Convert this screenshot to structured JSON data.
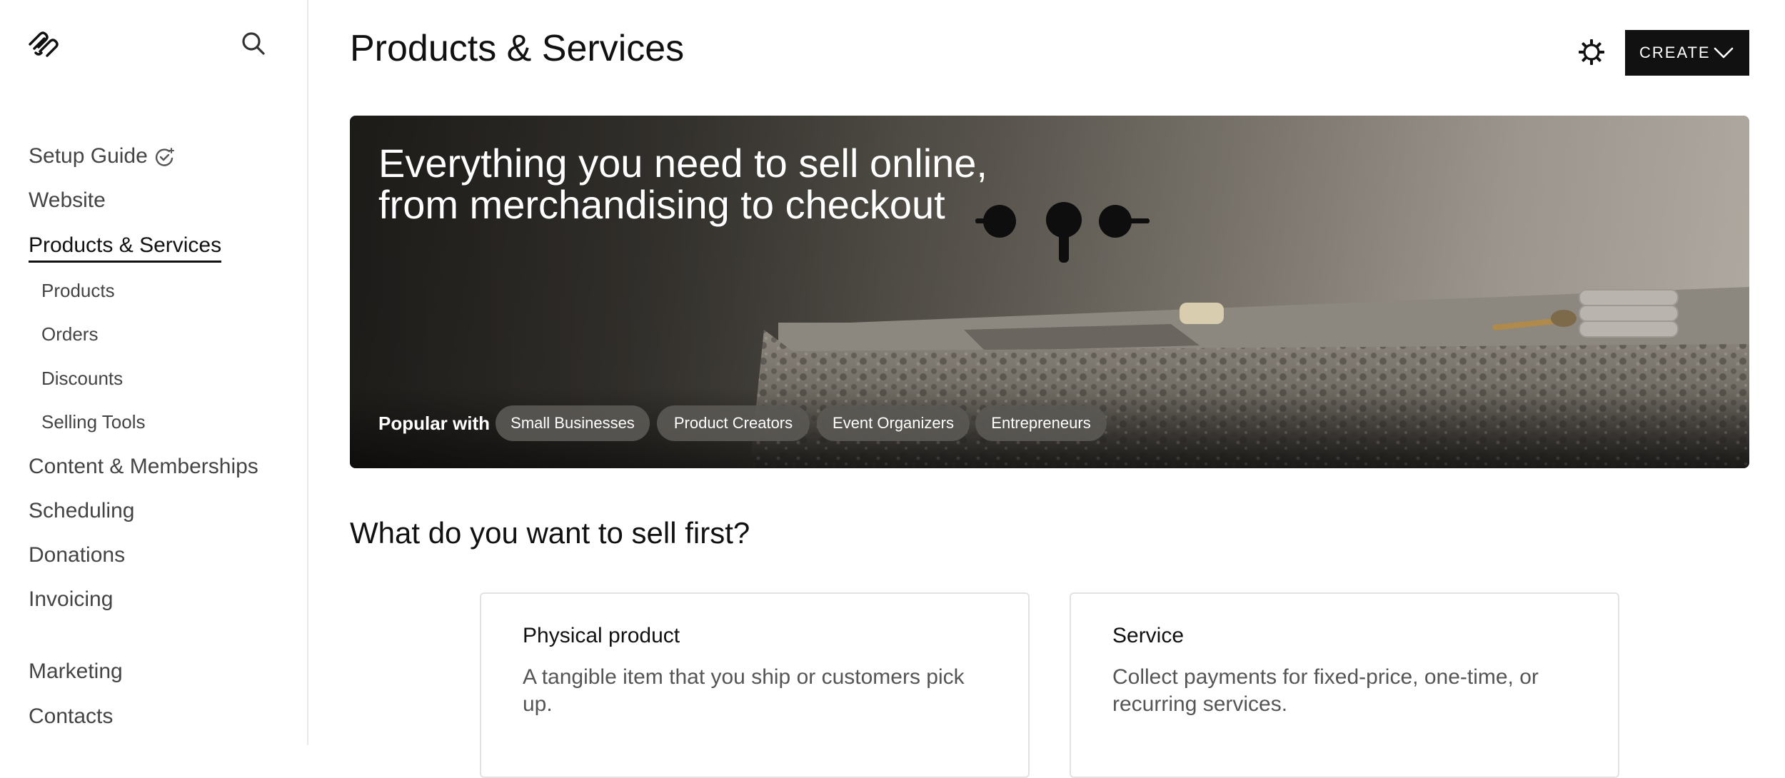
{
  "sidebar": {
    "logo_icon": "squarespace-logo-icon",
    "search_icon": "search-icon",
    "setup_guide": "Setup Guide",
    "items": [
      {
        "label": "Website"
      },
      {
        "label": "Products & Services"
      },
      {
        "label": "Content & Memberships"
      },
      {
        "label": "Scheduling"
      },
      {
        "label": "Donations"
      },
      {
        "label": "Invoicing"
      },
      {
        "label": "Marketing"
      },
      {
        "label": "Contacts"
      }
    ],
    "subitems": [
      {
        "label": "Products"
      },
      {
        "label": "Orders"
      },
      {
        "label": "Discounts"
      },
      {
        "label": "Selling Tools"
      }
    ],
    "active": "Products & Services"
  },
  "header": {
    "title": "Products & Services",
    "settings_icon": "gear-icon",
    "create_label": "CREATE"
  },
  "hero": {
    "heading_line1": "Everything you need to sell online,",
    "heading_line2": "from merchandising to checkout",
    "popular_label": "Popular with",
    "tags": [
      "Small Businesses",
      "Product Creators",
      "Event Organizers",
      "Entrepreneurs"
    ]
  },
  "section": {
    "title": "What do you want to sell first?"
  },
  "cards": [
    {
      "title": "Physical product",
      "description": "A tangible item that you ship or customers pick up."
    },
    {
      "title": "Service",
      "description": "Collect payments for fixed-price, one-time, or recurring services."
    }
  ],
  "colors": {
    "accent": "#111111",
    "sidebar_border": "#e8e8e8",
    "pill_bg": "#5a5854"
  }
}
